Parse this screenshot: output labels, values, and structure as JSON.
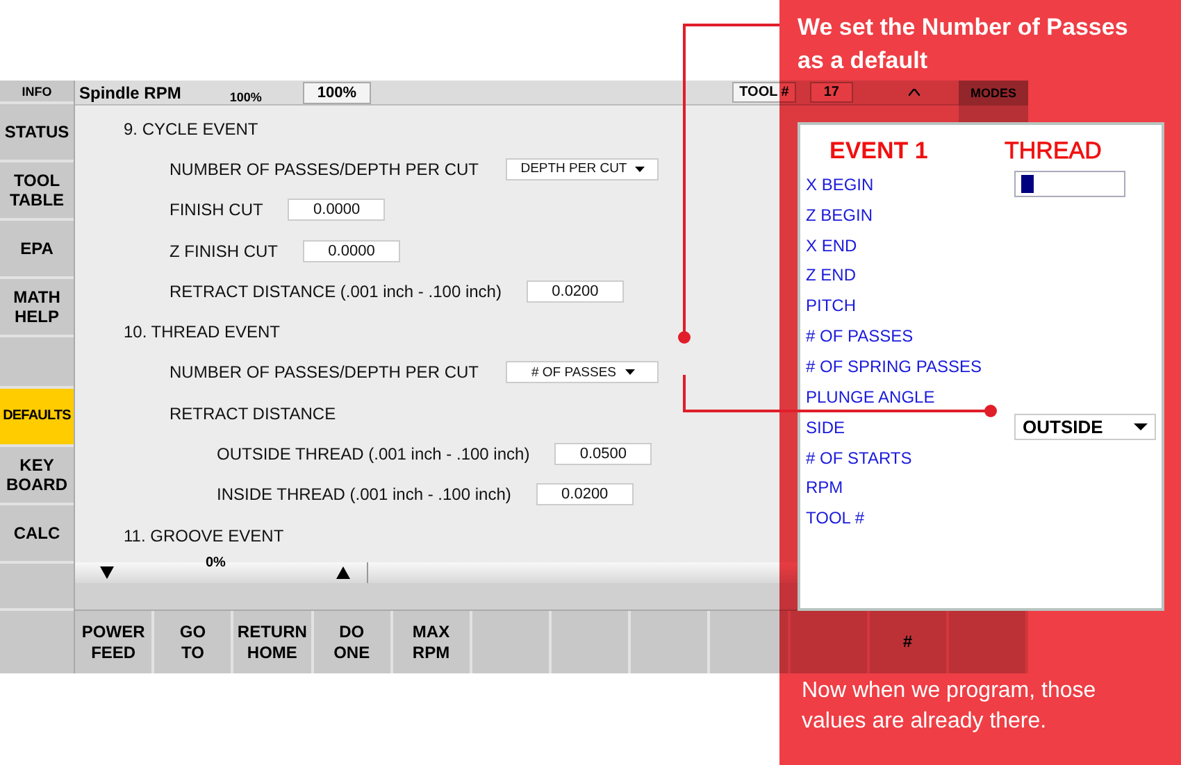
{
  "sidebar": {
    "groups": [
      {
        "items": [
          {
            "label": "INFO",
            "selected": false
          },
          {
            "label": "STATUS",
            "selected": false
          },
          {
            "label": "TOOL TABLE",
            "selected": false
          },
          {
            "label": "EPA",
            "selected": false
          },
          {
            "label": "MATH HELP",
            "selected": false
          }
        ]
      },
      {
        "items": [
          {
            "label": "DEFAULTS",
            "selected": true
          },
          {
            "label": "KEY BOARD",
            "selected": false
          },
          {
            "label": "CALC",
            "selected": false
          }
        ]
      }
    ]
  },
  "top_bar": {
    "title": "Spindle RPM",
    "readout": "100%",
    "override": "100%",
    "tool_label": "TOOL #",
    "tool_number": "17",
    "modes": "MODES"
  },
  "settings": [
    {
      "heading": "9. CYCLE EVENT",
      "rows": [
        {
          "kind": "select",
          "label": "NUMBER OF PASSES/DEPTH PER CUT",
          "value": "DEPTH PER CUT"
        },
        {
          "kind": "field",
          "label": "FINISH CUT",
          "value": "0.0000"
        },
        {
          "kind": "field",
          "label": "Z FINISH CUT",
          "value": "0.0000"
        },
        {
          "kind": "field",
          "label": "RETRACT DISTANCE  (.001 inch - .100 inch)",
          "value": "0.0200"
        }
      ]
    },
    {
      "heading": "10. THREAD EVENT",
      "rows": [
        {
          "kind": "select",
          "label": "NUMBER OF PASSES/DEPTH PER CUT",
          "value": "# OF PASSES"
        },
        {
          "kind": "label",
          "label": "RETRACT DISTANCE",
          "children": [
            {
              "kind": "field",
              "label": "OUTSIDE THREAD  (.001 inch - .100 inch)",
              "value": "0.0500"
            },
            {
              "kind": "field",
              "label": "INSIDE THREAD  (.001 inch - .100 inch)",
              "value": "0.0200"
            }
          ]
        }
      ]
    },
    {
      "heading": "11. GROOVE EVENT"
    }
  ],
  "feed_strip": {
    "percent": "0%"
  },
  "function_keys": [
    {
      "kind": "key",
      "label": "POWER FEED"
    },
    {
      "kind": "key",
      "label": "GO TO"
    },
    {
      "kind": "key",
      "label": "RETURN HOME"
    },
    {
      "kind": "key",
      "label": "DO ONE"
    },
    {
      "kind": "key",
      "label": "MAX RPM"
    },
    {
      "kind": "blank"
    },
    {
      "kind": "blank"
    },
    {
      "kind": "blank"
    },
    {
      "kind": "blank"
    },
    {
      "kind": "blank"
    },
    {
      "kind": "key",
      "label": "#"
    },
    {
      "kind": "blank"
    }
  ],
  "callout": {
    "heading": "We set the Number of Passes as a default",
    "footer": "Now when we program, those values are already there."
  },
  "event": {
    "title": "EVENT 1",
    "type": "THREAD",
    "rows": [
      {
        "kind": "field",
        "label": "X BEGIN",
        "focused": true
      },
      {
        "kind": "label",
        "label": "Z BEGIN"
      },
      {
        "kind": "label",
        "label": "X END"
      },
      {
        "kind": "label",
        "label": "Z END"
      },
      {
        "kind": "label",
        "label": "PITCH"
      },
      {
        "kind": "label",
        "label": "# OF PASSES"
      },
      {
        "kind": "label",
        "label": "# OF SPRING PASSES"
      },
      {
        "kind": "label",
        "label": "PLUNGE ANGLE"
      },
      {
        "kind": "select",
        "label": "SIDE",
        "value": "OUTSIDE"
      },
      {
        "kind": "label",
        "label": "# OF STARTS"
      },
      {
        "kind": "label",
        "label": "RPM"
      },
      {
        "kind": "label",
        "label": "TOOL #"
      }
    ]
  }
}
